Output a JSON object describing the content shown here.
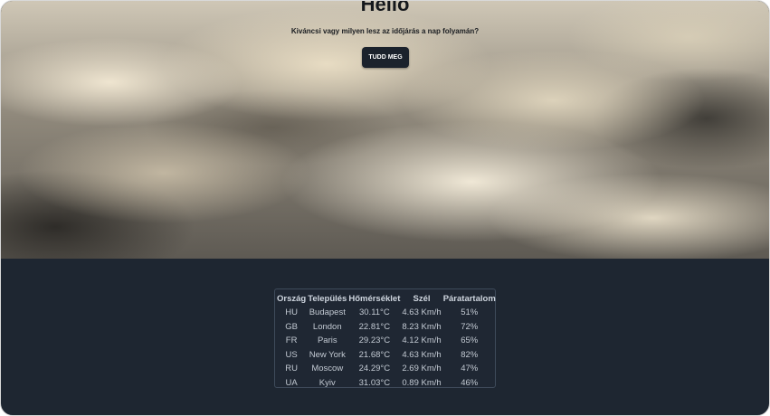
{
  "hero": {
    "title": "Hello",
    "subtitle": "Kiváncsi vagy milyen lesz az időjárás a nap folyamán?",
    "button_label": "TUDD MEG"
  },
  "weather_table": {
    "headers": [
      "Ország",
      "Település",
      "Hőmérséklet",
      "Szél",
      "Páratartalom"
    ],
    "rows": [
      [
        "HU",
        "Budapest",
        "30.11°C",
        "4.63 Km/h",
        "51%"
      ],
      [
        "GB",
        "London",
        "22.81°C",
        "8.23 Km/h",
        "72%"
      ],
      [
        "FR",
        "Paris",
        "29.23°C",
        "4.12 Km/h",
        "65%"
      ],
      [
        "US",
        "New York",
        "21.68°C",
        "4.63 Km/h",
        "82%"
      ],
      [
        "RU",
        "Moscow",
        "24.29°C",
        "2.69 Km/h",
        "47%"
      ],
      [
        "UA",
        "Kyiv",
        "31.03°C",
        "0.89 Km/h",
        "46%"
      ]
    ]
  }
}
